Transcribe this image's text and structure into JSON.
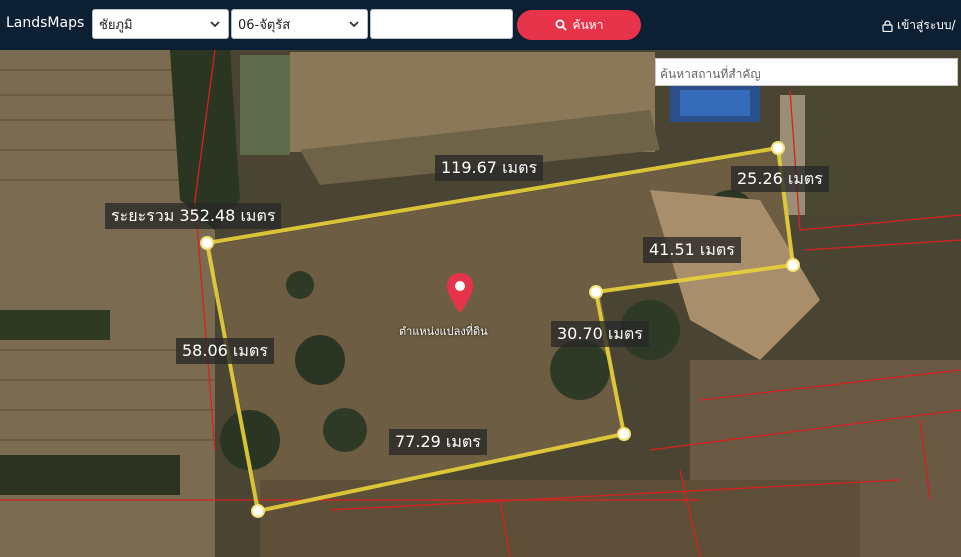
{
  "header": {
    "brand": "LandsMaps",
    "province_select": "ชัยภูมิ",
    "district_select": "06-จัตุรัส",
    "parcel_input_value": "",
    "search_label": "ค้นหา",
    "login_label": "เข้าสู่ระบบ/"
  },
  "map": {
    "place_search_placeholder": "ค้นหาสถานที่สำคัญ",
    "pin_label": "ตำแหน่งแปลงที่ดิน",
    "total_distance_label": "ระยะรวม 352.48 เมตร",
    "segments": [
      {
        "id": "top",
        "label": "119.67 เมตร"
      },
      {
        "id": "right-upper",
        "label": "25.26 เมตร"
      },
      {
        "id": "step",
        "label": "41.51 เมตร"
      },
      {
        "id": "inner-right",
        "label": "30.70 เมตร"
      },
      {
        "id": "bottom",
        "label": "77.29 เมตร"
      },
      {
        "id": "left",
        "label": "58.06 เมตร"
      }
    ]
  },
  "colors": {
    "header_bg": "#0d1f33",
    "search_button": "#e8344a",
    "measure_line": "#e8d13a",
    "parcel_boundary": "#d82020",
    "pin": "#e8344a"
  }
}
